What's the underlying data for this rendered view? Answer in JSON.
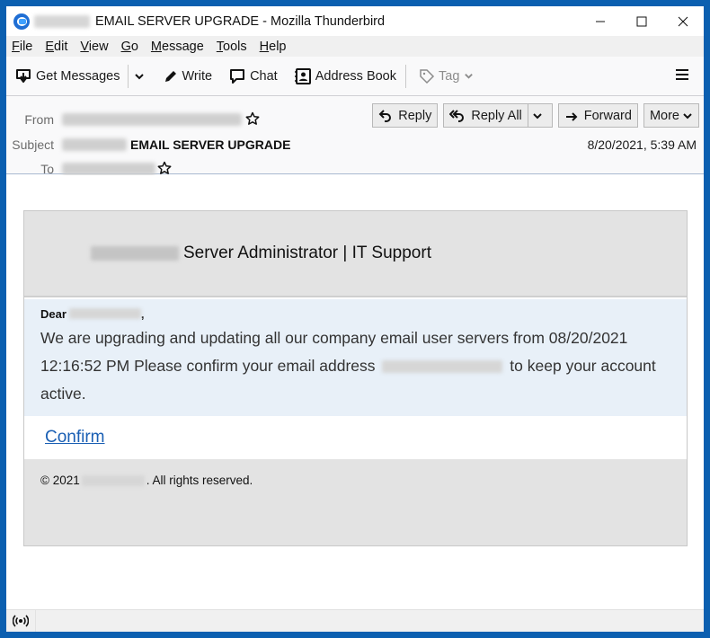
{
  "window": {
    "title_suffix": "EMAIL SERVER UPGRADE - Mozilla Thunderbird",
    "controls": [
      "minimize",
      "maximize",
      "close"
    ]
  },
  "menubar": {
    "items": [
      {
        "label": "File",
        "accel": "F"
      },
      {
        "label": "Edit",
        "accel": "E"
      },
      {
        "label": "View",
        "accel": "V"
      },
      {
        "label": "Go",
        "accel": "G"
      },
      {
        "label": "Message",
        "accel": "M"
      },
      {
        "label": "Tools",
        "accel": "T"
      },
      {
        "label": "Help",
        "accel": "H"
      }
    ]
  },
  "toolbar": {
    "get_messages": "Get Messages",
    "write": "Write",
    "chat": "Chat",
    "address_book": "Address Book",
    "tag": "Tag"
  },
  "header": {
    "from_label": "From",
    "subject_label": "Subject",
    "to_label": "To",
    "subject": "EMAIL SERVER UPGRADE",
    "date": "8/20/2021, 5:39 AM",
    "actions": {
      "reply": "Reply",
      "reply_all": "Reply All",
      "forward": "Forward",
      "more": "More"
    }
  },
  "email": {
    "header_title": "Server Administrator | IT Support",
    "greeting": "Dear",
    "greeting_end": ",",
    "message_part1": "We are upgrading and updating all our company email user servers from 08/20/2021 12:16:52 PM Please confirm your email address",
    "message_part2": "to keep your account active.",
    "confirm_link": "Confirm",
    "footer_prefix": "© 2021",
    "footer_suffix": ". All rights reserved."
  },
  "colors": {
    "window_border": "#0b5fb0",
    "link": "#1a5fb4",
    "card_gray": "#e3e3e3",
    "message_bg": "#e8f0f8"
  }
}
